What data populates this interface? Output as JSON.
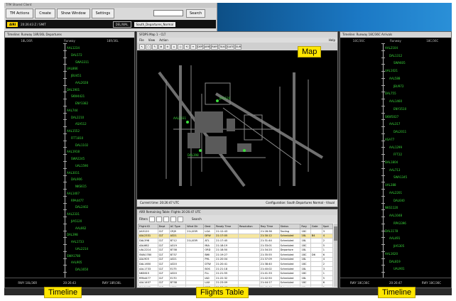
{
  "topbar": {
    "window_title": "TFM Shared Client",
    "menus": [
      "TM Actions",
      "Create",
      "Show Window",
      "Settings"
    ],
    "search_label": "Search",
    "mode_badge": "AIRI",
    "clock": "20:26:43 Z / SMIT",
    "field1": "DEL/WAL",
    "view_select": "South_Departures_Normal"
  },
  "left_timeline": {
    "title": "Timeline: Runway 18R/36L Departures",
    "header": "Runway",
    "col_left": "18L/36R",
    "col_right": "18R/36L",
    "flights": [
      "AAL1234",
      "DAL572",
      "SWA3311",
      "UAL866",
      "JBU451",
      "AAL2028",
      "DAL1901",
      "SKW4421",
      "ENY3382",
      "AAL744",
      "DAL2210",
      "ASA512",
      "AAL1552",
      "FFT1810",
      "DAL1102",
      "AAL1918",
      "SWA2245",
      "UAL1590",
      "AAL3011",
      "DAL906",
      "NKS615",
      "AAL1407",
      "RPA4477",
      "DAL2402",
      "AAL2331",
      "JIA5120",
      "AAL662",
      "DAL398",
      "AAL1733",
      "UAL2214",
      "SWA1780",
      "AAL905",
      "DAL1650"
    ],
    "foot_left": "RWY 18L/36R",
    "foot_time": "20:26:43",
    "foot_right": "RWY 18R/36L"
  },
  "map": {
    "title": "SFDPS Map 1 - CLT",
    "menu": [
      "File",
      "View",
      "Action"
    ],
    "menu_right": "Help",
    "tools": [
      "↖",
      "▢",
      "✎",
      "⊕",
      "⊖",
      "⌂",
      "◎",
      "⟲",
      "↔",
      "DEP",
      "ARR",
      "RWY",
      "TAXI",
      "GATE",
      "SUR"
    ],
    "status_left": "Current time: 20:26:47 UTC",
    "status_right": "Configuration: South Departures Normal - Visual"
  },
  "flights_table": {
    "title": "ARR Remaining Table: Flights 20:26:47 UTC",
    "toolbar_label": "Filters",
    "search_label": "Search",
    "columns": [
      "Flight ID",
      "Dept",
      "AC Type",
      "Wind Dir",
      "Dest",
      "Ready Time",
      "Resolution",
      "Rwy Time",
      "Status",
      "Rwy",
      "Gate",
      "Spot"
    ],
    "rows": [
      [
        "JIA5120",
        "CLT",
        "CRJ9",
        "21L/03R",
        "LGA",
        "21:12:43",
        "",
        "21:28:36",
        "Taxiing",
        "18C",
        "",
        "3"
      ],
      [
        "AAL2331",
        "CLT",
        "A321",
        "",
        "DFW",
        "21:17:05",
        "",
        "21:30:12",
        "Scheduled",
        "18L",
        "B4",
        "4"
      ],
      [
        "DAL398",
        "CLT",
        "B712",
        "21L/03R",
        "ATL",
        "21:17:45",
        "",
        "21:31:44",
        "Scheduled",
        "18L",
        "",
        "2"
      ],
      [
        "AAL662",
        "CLT",
        "A319",
        "",
        "MIA",
        "21:18:19",
        "",
        "21:33:01",
        "Scheduled",
        "18C",
        "",
        "5"
      ],
      [
        "UAL2214",
        "CLT",
        "B738",
        "",
        "ORD",
        "21:18:50",
        "",
        "21:34:20",
        "Departure",
        "18L",
        "",
        "1"
      ],
      [
        "SWA1780",
        "CLT",
        "B737",
        "",
        "BWI",
        "21:19:27",
        "",
        "21:35:55",
        "Scheduled",
        "18C",
        "D6",
        "6"
      ],
      [
        "AAL905",
        "CLT",
        "A321",
        "",
        "PHL",
        "21:20:04",
        "",
        "21:37:09",
        "Scheduled",
        "18L",
        "",
        "4"
      ],
      [
        "DAL1650",
        "CLT",
        "A320",
        "",
        "DTW",
        "21:20:41",
        "",
        "21:38:40",
        "Scheduled",
        "18C",
        "",
        "2"
      ],
      [
        "AAL1733",
        "CLT",
        "E175",
        "",
        "BOS",
        "21:21:18",
        "",
        "21:40:02",
        "Scheduled",
        "18L",
        "",
        "3"
      ],
      [
        "NKS615",
        "CLT",
        "A320",
        "",
        "FLL",
        "21:21:55",
        "",
        "21:41:33",
        "Scheduled",
        "18C",
        "",
        "1"
      ],
      [
        "RPA4477",
        "CLT",
        "E170",
        "",
        "IAD",
        "21:22:32",
        "",
        "21:42:50",
        "Scheduled",
        "18L",
        "",
        "5"
      ],
      [
        "AAL1407",
        "CLT",
        "B738",
        "",
        "LAX",
        "21:23:09",
        "",
        "21:44:17",
        "Scheduled",
        "18C",
        "",
        "6"
      ],
      [
        "DAL2402",
        "CLT",
        "A321",
        "",
        "MSP",
        "21:23:46",
        "",
        "21:45:38",
        "Scheduled",
        "18L",
        "",
        "2"
      ],
      [
        "AAL3011",
        "CLT",
        "A319",
        "",
        "TPA",
        "21:24:23",
        "",
        "21:47:05",
        "Scheduled",
        "18C",
        "",
        "4"
      ],
      [
        "DAL906",
        "CLT",
        "B712",
        "",
        "ATL",
        "21:25:00",
        "",
        "21:48:29",
        "Scheduled",
        "18L",
        "",
        "1"
      ]
    ]
  },
  "right_timeline": {
    "title": "Timeline: Runway 18C/36C Arrivals",
    "header": "Runway",
    "col_left": "18C/36C",
    "col_right": "18C/36C",
    "flights": [
      "AAL2104",
      "DAL1312",
      "SWA605",
      "UAL1021",
      "AAL588",
      "JBU972",
      "DAL755",
      "AAL1460",
      "ENY3510",
      "SKW5027",
      "AAL317",
      "DAL2011",
      "ASA77",
      "AAL1299",
      "FFT22",
      "DAL1804",
      "AAL713",
      "SWA1345",
      "UAL388",
      "AAL2201",
      "DAL640",
      "NKS1120",
      "AAL1048",
      "RPA3396",
      "DAL1178",
      "AAL491",
      "JIA5305",
      "AAL1620",
      "DAL819",
      "UAL901"
    ],
    "foot_left": "RWY 18C/36C",
    "foot_time": "20:26:47",
    "foot_right": "RWY 18C/36C"
  },
  "callouts": {
    "map": "Map",
    "timeline_left": "Timeline",
    "flights": "Flights Table",
    "timeline_right": "Timeline"
  }
}
